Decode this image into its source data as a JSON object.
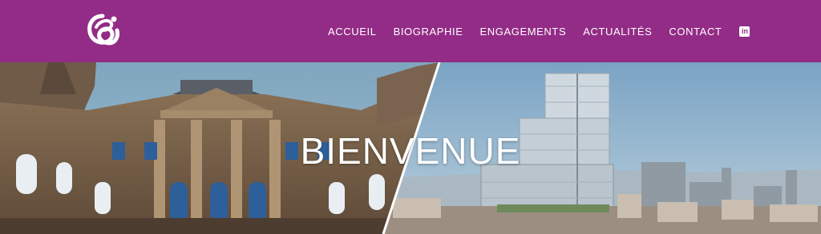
{
  "header": {
    "background": "#932c86",
    "logo_icon": "e-monogram-logo",
    "nav": [
      {
        "label": "ACCUEIL"
      },
      {
        "label": "BIOGRAPHIE"
      },
      {
        "label": "ENGAGEMENTS"
      },
      {
        "label": "ACTUALITÉS"
      },
      {
        "label": "CONTACT"
      }
    ],
    "social_icon": "linkedin-icon"
  },
  "hero": {
    "title": "BIENVENUE",
    "image_left": "historic-courthouse-facade",
    "image_right": "modern-tower-city-skyline"
  }
}
